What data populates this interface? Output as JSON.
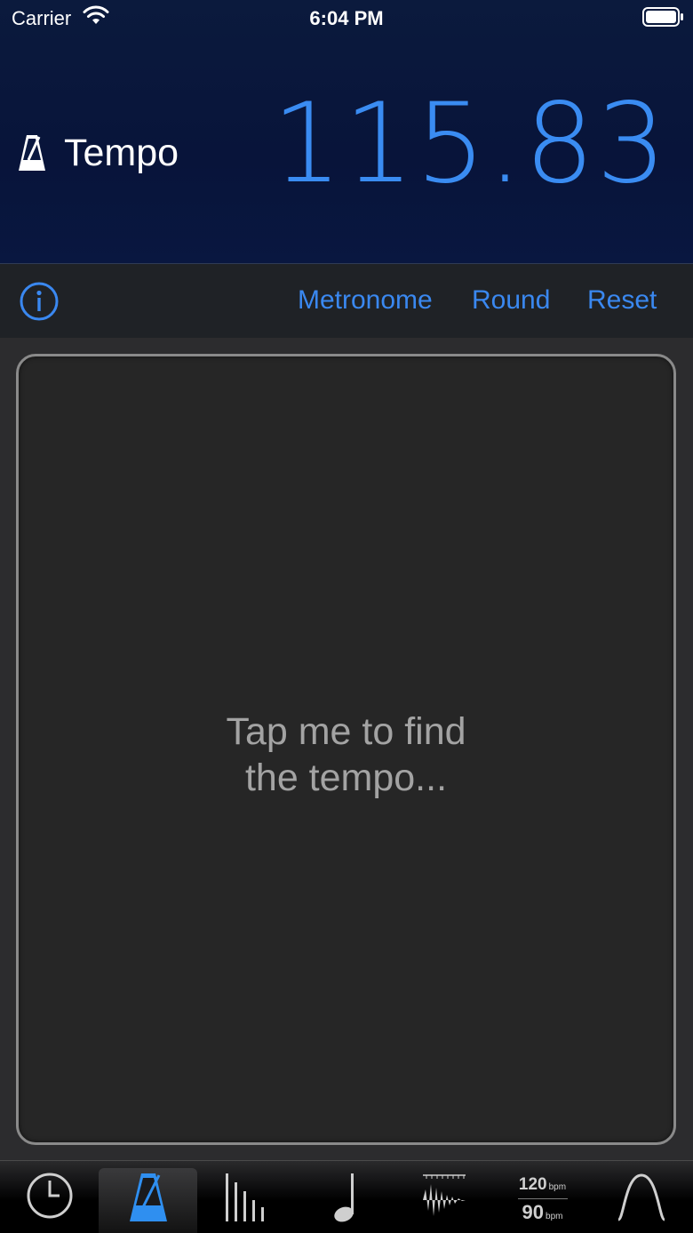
{
  "status_bar": {
    "carrier": "Carrier",
    "time": "6:04 PM"
  },
  "header": {
    "title": "Tempo",
    "title_icon": "metronome-icon",
    "tempo_value": "115.83"
  },
  "toolbar": {
    "info_icon": "info-icon",
    "metronome_label": "Metronome",
    "round_label": "Round",
    "reset_label": "Reset",
    "accent_color": "#3a88f0"
  },
  "tap_area": {
    "line1": "Tap me to find",
    "line2": "the tempo..."
  },
  "tabbar": {
    "tabs": [
      {
        "icon": "clock-icon",
        "active": false
      },
      {
        "icon": "metronome-icon",
        "active": true
      },
      {
        "icon": "bars-icon",
        "active": false
      },
      {
        "icon": "music-note-icon",
        "active": false
      },
      {
        "icon": "waveform-icon",
        "active": false
      },
      {
        "icon": "bpm-convert-icon",
        "active": false,
        "top": "120",
        "top_unit": "bpm",
        "bottom": "90",
        "bottom_unit": "bpm"
      },
      {
        "icon": "sine-wave-icon",
        "active": false
      }
    ]
  }
}
